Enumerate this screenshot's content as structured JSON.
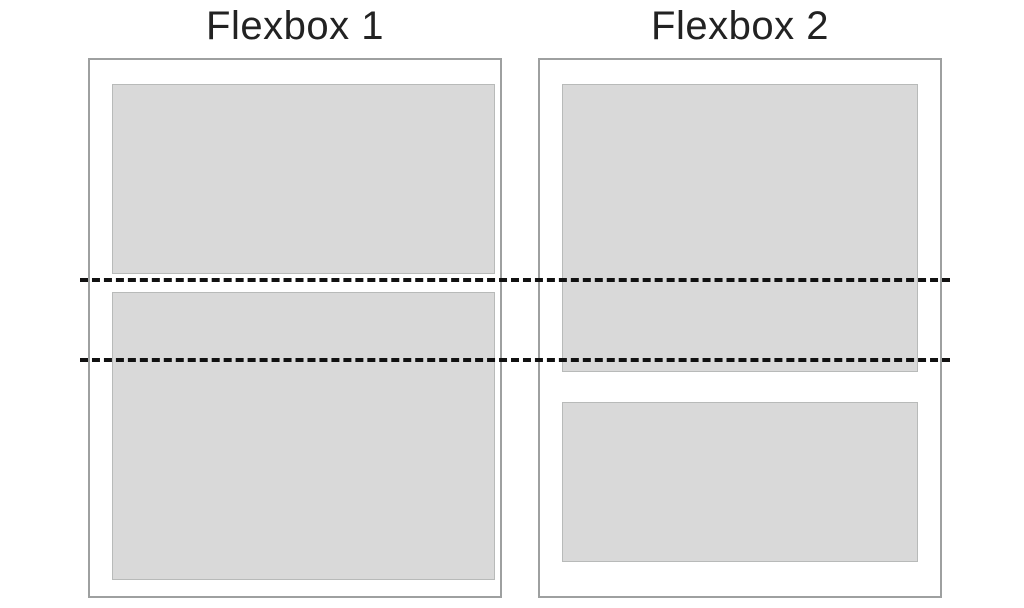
{
  "titles": {
    "left": "Flexbox 1",
    "right": "Flexbox 2"
  },
  "diagram": {
    "left": {
      "items": [
        {
          "flex_ratio": 0.4
        },
        {
          "flex_ratio": 0.6
        }
      ]
    },
    "right": {
      "items": [
        {
          "flex_ratio": 0.6
        },
        {
          "flex_ratio": 0.4
        }
      ]
    },
    "guides": 2
  }
}
